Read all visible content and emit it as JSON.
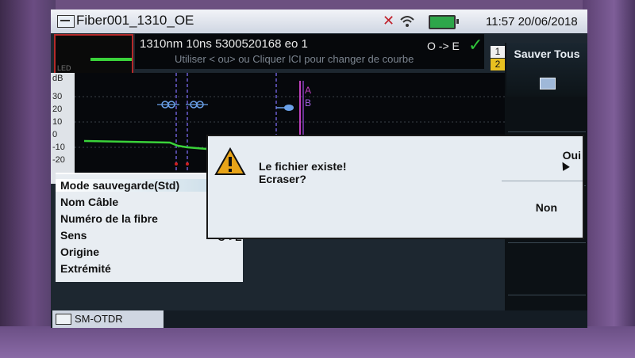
{
  "window": {
    "title": "Fiber001_1310_OE"
  },
  "status": {
    "datetime": "11:57 20/06/2018"
  },
  "measurement": {
    "info": "1310nm  10ns  5300520168 eo  1",
    "hint": "Utiliser < ou> ou Cliquer ICI pour changer de courbe",
    "direction": "O -> E",
    "trace_1": "1",
    "trace_2": "2"
  },
  "thumbnail": {
    "label": "LED"
  },
  "graph": {
    "unit": "dB",
    "y_ticks": [
      "30",
      "20",
      "10",
      "0",
      "-10",
      "-20"
    ],
    "marker_a": "A",
    "marker_b": "B"
  },
  "side_panel": {
    "save_all": "Sauver Tous"
  },
  "dialog": {
    "message_1": "Le fichier existe!",
    "message_2": "Ecraser?",
    "yes": "Oui",
    "no": "Non"
  },
  "menu": {
    "items": [
      "Mode sauvegarde(Std)",
      "Nom Câble",
      "Numéro de la fibre",
      "Sens",
      "Origine",
      "Extrémité"
    ],
    "sens_value": "O->E"
  },
  "footer": {
    "mode": "SM-OTDR"
  }
}
